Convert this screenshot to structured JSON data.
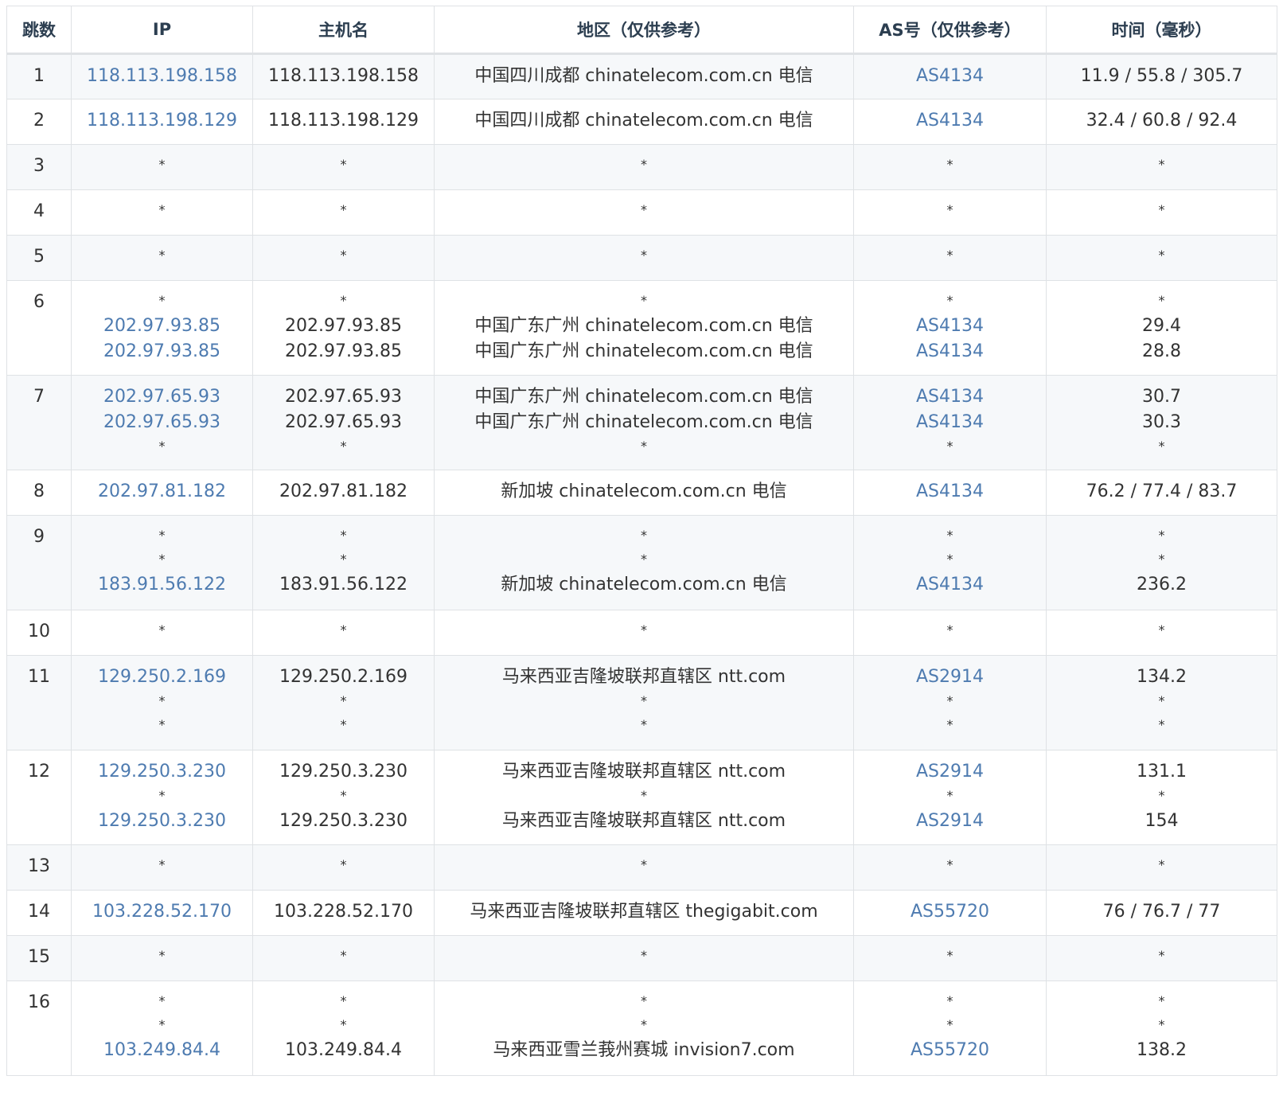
{
  "colors": {
    "link": "#4e7bb0",
    "text": "#333333",
    "header": "#2c3e50",
    "stripe": "#f6f8fa",
    "border": "#dfe2e5"
  },
  "headers": {
    "hop": "跳数",
    "ip": "IP",
    "host": "主机名",
    "region": "地区（仅供参考）",
    "as": "AS号（仅供参考）",
    "time": "时间（毫秒）"
  },
  "rows": [
    {
      "hop": "1",
      "ip": [
        "118.113.198.158"
      ],
      "host": [
        "118.113.198.158"
      ],
      "region": [
        "中国四川成都 chinatelecom.com.cn 电信"
      ],
      "as": [
        "AS4134"
      ],
      "time": [
        "11.9 / 55.8 / 305.7"
      ]
    },
    {
      "hop": "2",
      "ip": [
        "118.113.198.129"
      ],
      "host": [
        "118.113.198.129"
      ],
      "region": [
        "中国四川成都 chinatelecom.com.cn 电信"
      ],
      "as": [
        "AS4134"
      ],
      "time": [
        "32.4 / 60.8 / 92.4"
      ]
    },
    {
      "hop": "3",
      "ip": [
        "*"
      ],
      "host": [
        "*"
      ],
      "region": [
        "*"
      ],
      "as": [
        "*"
      ],
      "time": [
        "*"
      ]
    },
    {
      "hop": "4",
      "ip": [
        "*"
      ],
      "host": [
        "*"
      ],
      "region": [
        "*"
      ],
      "as": [
        "*"
      ],
      "time": [
        "*"
      ]
    },
    {
      "hop": "5",
      "ip": [
        "*"
      ],
      "host": [
        "*"
      ],
      "region": [
        "*"
      ],
      "as": [
        "*"
      ],
      "time": [
        "*"
      ]
    },
    {
      "hop": "6",
      "ip": [
        "*",
        "202.97.93.85",
        "202.97.93.85"
      ],
      "host": [
        "*",
        "202.97.93.85",
        "202.97.93.85"
      ],
      "region": [
        "*",
        "中国广东广州 chinatelecom.com.cn 电信",
        "中国广东广州 chinatelecom.com.cn 电信"
      ],
      "as": [
        "*",
        "AS4134",
        "AS4134"
      ],
      "time": [
        "*",
        "29.4",
        "28.8"
      ]
    },
    {
      "hop": "7",
      "ip": [
        "202.97.65.93",
        "202.97.65.93",
        "*"
      ],
      "host": [
        "202.97.65.93",
        "202.97.65.93",
        "*"
      ],
      "region": [
        "中国广东广州 chinatelecom.com.cn 电信",
        "中国广东广州 chinatelecom.com.cn 电信",
        "*"
      ],
      "as": [
        "AS4134",
        "AS4134",
        "*"
      ],
      "time": [
        "30.7",
        "30.3",
        "*"
      ]
    },
    {
      "hop": "8",
      "ip": [
        "202.97.81.182"
      ],
      "host": [
        "202.97.81.182"
      ],
      "region": [
        "新加坡 chinatelecom.com.cn 电信"
      ],
      "as": [
        "AS4134"
      ],
      "time": [
        "76.2 / 77.4 / 83.7"
      ]
    },
    {
      "hop": "9",
      "ip": [
        "*",
        "*",
        "183.91.56.122"
      ],
      "host": [
        "*",
        "*",
        "183.91.56.122"
      ],
      "region": [
        "*",
        "*",
        "新加坡 chinatelecom.com.cn 电信"
      ],
      "as": [
        "*",
        "*",
        "AS4134"
      ],
      "time": [
        "*",
        "*",
        "236.2"
      ]
    },
    {
      "hop": "10",
      "ip": [
        "*"
      ],
      "host": [
        "*"
      ],
      "region": [
        "*"
      ],
      "as": [
        "*"
      ],
      "time": [
        "*"
      ]
    },
    {
      "hop": "11",
      "ip": [
        "129.250.2.169",
        "*",
        "*"
      ],
      "host": [
        "129.250.2.169",
        "*",
        "*"
      ],
      "region": [
        "马来西亚吉隆坡联邦直辖区 ntt.com",
        "*",
        "*"
      ],
      "as": [
        "AS2914",
        "*",
        "*"
      ],
      "time": [
        "134.2",
        "*",
        "*"
      ]
    },
    {
      "hop": "12",
      "ip": [
        "129.250.3.230",
        "*",
        "129.250.3.230"
      ],
      "host": [
        "129.250.3.230",
        "*",
        "129.250.3.230"
      ],
      "region": [
        "马来西亚吉隆坡联邦直辖区 ntt.com",
        "*",
        "马来西亚吉隆坡联邦直辖区 ntt.com"
      ],
      "as": [
        "AS2914",
        "*",
        "AS2914"
      ],
      "time": [
        "131.1",
        "*",
        "154"
      ]
    },
    {
      "hop": "13",
      "ip": [
        "*"
      ],
      "host": [
        "*"
      ],
      "region": [
        "*"
      ],
      "as": [
        "*"
      ],
      "time": [
        "*"
      ]
    },
    {
      "hop": "14",
      "ip": [
        "103.228.52.170"
      ],
      "host": [
        "103.228.52.170"
      ],
      "region": [
        "马来西亚吉隆坡联邦直辖区 thegigabit.com"
      ],
      "as": [
        "AS55720"
      ],
      "time": [
        "76 / 76.7 / 77"
      ]
    },
    {
      "hop": "15",
      "ip": [
        "*"
      ],
      "host": [
        "*"
      ],
      "region": [
        "*"
      ],
      "as": [
        "*"
      ],
      "time": [
        "*"
      ]
    },
    {
      "hop": "16",
      "ip": [
        "*",
        "*",
        "103.249.84.4"
      ],
      "host": [
        "*",
        "*",
        "103.249.84.4"
      ],
      "region": [
        "*",
        "*",
        "马来西亚雪兰莪州赛城 invision7.com"
      ],
      "as": [
        "*",
        "*",
        "AS55720"
      ],
      "time": [
        "*",
        "*",
        "138.2"
      ]
    }
  ]
}
